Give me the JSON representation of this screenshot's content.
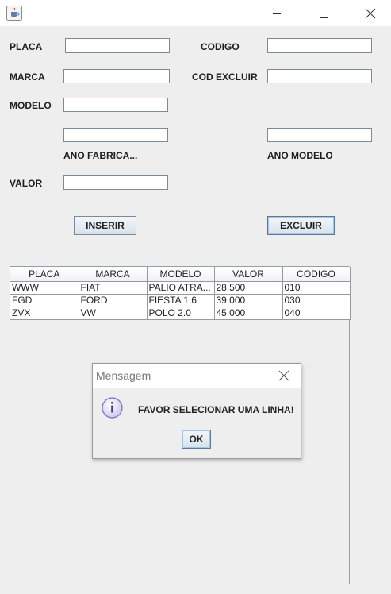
{
  "window": {
    "icon": "java-cup-icon",
    "controls": [
      "minimize-icon",
      "maximize-icon",
      "close-icon"
    ]
  },
  "form": {
    "placa_label": "PLACA",
    "marca_label": "MARCA",
    "modelo_label": "MODELO",
    "valor_label": "VALOR",
    "codigo_label": "CODIGO",
    "cod_excluir_label": "COD EXCLUIR",
    "ano_fabrica_label": "ANO FABRICA...",
    "ano_modelo_label": "ANO MODELO",
    "placa_value": "",
    "marca_value": "",
    "modelo_value": "",
    "ano_fabrica_value": "",
    "valor_value": "",
    "codigo_value": "",
    "cod_excluir_value": "",
    "ano_modelo_value": ""
  },
  "buttons": {
    "inserir": "INSERIR",
    "excluir": "EXCLUIR"
  },
  "table": {
    "columns": [
      "PLACA",
      "MARCA",
      "MODELO",
      "VALOR",
      "CODIGO"
    ],
    "rows": [
      [
        "WWW",
        "FIAT",
        "PALIO ATRA...",
        "28.500",
        "010"
      ],
      [
        "FGD",
        "FORD",
        "FIESTA 1.6",
        "39.000",
        "030"
      ],
      [
        "ZVX",
        "VW",
        "POLO 2.0",
        "45.000",
        "040"
      ]
    ]
  },
  "dialog": {
    "title": "Mensagem",
    "message": "FAVOR SELECIONAR UMA LINHA!",
    "ok_label": "OK",
    "icon": "info-icon"
  }
}
